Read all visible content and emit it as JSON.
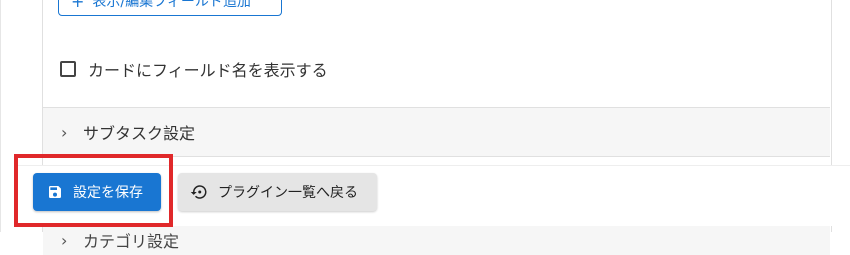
{
  "fields": {
    "add_button_label": "表示/編集フィールド追加",
    "add_icon": "plus-icon"
  },
  "card_option": {
    "label": "カードにフィールド名を表示する",
    "checked": false
  },
  "sections": {
    "subtask": "サブタスク設定",
    "category": "カテゴリ設定"
  },
  "actions": {
    "save_label": "設定を保存",
    "save_icon": "save-icon",
    "back_label": "プラグイン一覧へ戻る",
    "back_icon": "history-back-icon"
  },
  "colors": {
    "primary": "#1976d2",
    "highlight": "#e0282a",
    "secondary_button": "#e5e5e5"
  }
}
